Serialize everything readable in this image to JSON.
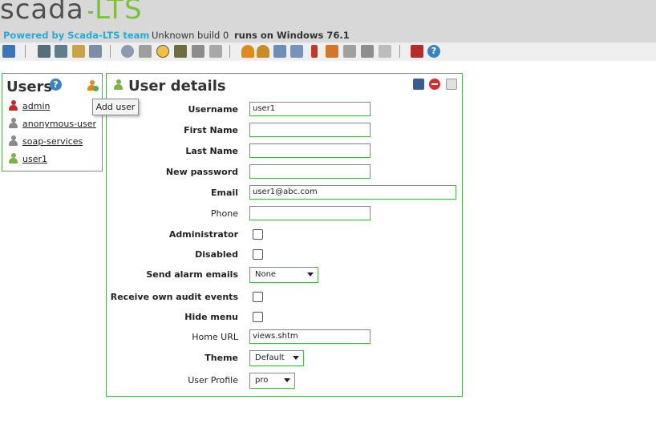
{
  "header": {
    "logo_main": "scada",
    "logo_accent": "LTS",
    "powered_by": "Powered by Scada-LTS team",
    "build": "Unknown build 0",
    "runs_on": "runs on Windows 76.1"
  },
  "toolbar": {
    "icons": [
      "watchlist-icon",
      "graphic-views-icon",
      "graphic-editor-icon",
      "reports-icon",
      "event-handlers-icon",
      "data-sources-icon",
      "scheduled-events-icon",
      "compound-events-icon",
      "point-links-icon",
      "scripting-icon",
      "users-icon",
      "user-profiles-icon",
      "point-hierarchy-icon",
      "mailing-lists-icon",
      "publishers-icon",
      "maintenance-events-icon",
      "system-settings-icon",
      "sql-icon",
      "import-export-icon",
      "logout-icon",
      "help-icon"
    ]
  },
  "users_panel": {
    "title": "Users",
    "add_user_tooltip": "Add user",
    "users": [
      {
        "name": "admin",
        "icon_color": "#c62828"
      },
      {
        "name": "anonymous-user",
        "icon_color": "#8a8a8a"
      },
      {
        "name": "soap-services",
        "icon_color": "#8a8a8a"
      },
      {
        "name": "user1",
        "icon_color": "#7cb342"
      }
    ]
  },
  "details": {
    "title": "User details",
    "labels": {
      "username": "Username",
      "first_name": "First Name",
      "last_name": "Last Name",
      "new_password": "New password",
      "email": "Email",
      "phone": "Phone",
      "administrator": "Administrator",
      "disabled": "Disabled",
      "send_alarm_emails": "Send alarm emails",
      "receive_own_audit": "Receive own audit events",
      "hide_menu": "Hide menu",
      "home_url": "Home URL",
      "theme": "Theme",
      "user_profile": "User Profile"
    },
    "values": {
      "username": "user1",
      "first_name": "",
      "last_name": "",
      "new_password": "",
      "email": "user1@abc.com",
      "phone": "",
      "send_alarm_emails": "None",
      "home_url": "views.shtm",
      "theme": "Default",
      "user_profile": "pro"
    },
    "checkboxes": {
      "administrator": false,
      "disabled": false,
      "receive_own_audit": false,
      "hide_menu": false
    }
  }
}
